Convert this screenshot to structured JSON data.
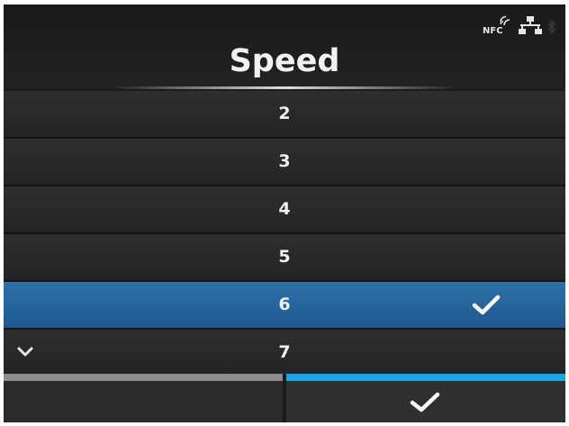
{
  "header": {
    "title": "Speed",
    "status": {
      "nfc_label": "NFC",
      "icons": [
        "nfc-icon",
        "network-icon",
        "bluetooth-icon"
      ]
    }
  },
  "list": {
    "items": [
      {
        "label": "2",
        "selected": false
      },
      {
        "label": "3",
        "selected": false
      },
      {
        "label": "4",
        "selected": false
      },
      {
        "label": "5",
        "selected": false
      },
      {
        "label": "6",
        "selected": true
      },
      {
        "label": "7",
        "selected": false
      }
    ],
    "more_below_icon": "chevron-down-icon",
    "selected_icon": "checkmark-icon"
  },
  "footer": {
    "left_button_icon": "none",
    "right_button_icon": "checkmark-icon"
  },
  "colors": {
    "background": "#1c1c1c",
    "selected_row": "#2663a0",
    "accent": "#16a8e6",
    "inactive_tab": "#8c8c8c",
    "text": "#f0f0f0"
  }
}
